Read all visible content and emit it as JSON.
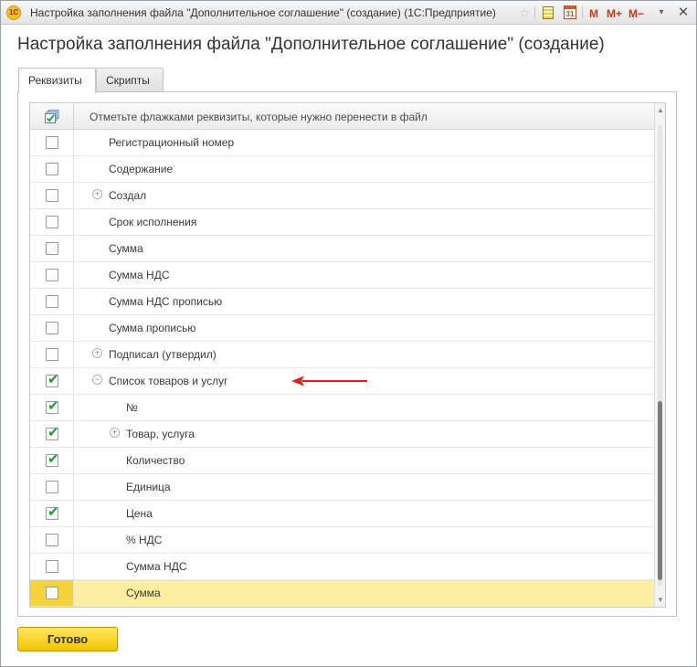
{
  "window": {
    "app_icon_text": "1С",
    "title": "Настройка заполнения файла \"Дополнительное соглашение\" (создание)  (1С:Предприятие)",
    "toolbar": {
      "calendar_day": "31",
      "m_label": "M",
      "m_plus_label": "M+",
      "m_minus_label": "M−",
      "menu_glyph": "▾",
      "close_glyph": "✕"
    }
  },
  "form": {
    "title": "Настройка заполнения файла \"Дополнительное соглашение\" (создание)",
    "tabs": [
      {
        "label": "Реквизиты",
        "active": true
      },
      {
        "label": "Скрипты",
        "active": false
      }
    ],
    "grid": {
      "header_text": "Отметьте флажками реквизиты, которые нужно перенести в файл",
      "rows": [
        {
          "label": "Регистрационный номер",
          "checked": false,
          "level": 1,
          "expander": ""
        },
        {
          "label": "Содержание",
          "checked": false,
          "level": 1,
          "expander": ""
        },
        {
          "label": "Создал",
          "checked": false,
          "level": 1,
          "expander": "+"
        },
        {
          "label": "Срок исполнения",
          "checked": false,
          "level": 1,
          "expander": ""
        },
        {
          "label": "Сумма",
          "checked": false,
          "level": 1,
          "expander": ""
        },
        {
          "label": "Сумма НДС",
          "checked": false,
          "level": 1,
          "expander": ""
        },
        {
          "label": "Сумма НДС прописью",
          "checked": false,
          "level": 1,
          "expander": ""
        },
        {
          "label": "Сумма прописью",
          "checked": false,
          "level": 1,
          "expander": ""
        },
        {
          "label": "Подписал (утвердил)",
          "checked": false,
          "level": 1,
          "expander": "+"
        },
        {
          "label": "Список товаров и услуг",
          "checked": true,
          "level": 1,
          "expander": "−"
        },
        {
          "label": "№",
          "checked": true,
          "level": 2,
          "expander": ""
        },
        {
          "label": "Товар, услуга",
          "checked": true,
          "level": 2,
          "expander": "+"
        },
        {
          "label": "Количество",
          "checked": true,
          "level": 2,
          "expander": ""
        },
        {
          "label": "Единица",
          "checked": false,
          "level": 2,
          "expander": ""
        },
        {
          "label": "Цена",
          "checked": true,
          "level": 2,
          "expander": ""
        },
        {
          "label": "% НДС",
          "checked": false,
          "level": 2,
          "expander": ""
        },
        {
          "label": "Сумма НДС",
          "checked": false,
          "level": 2,
          "expander": ""
        },
        {
          "label": "Сумма",
          "checked": false,
          "level": 2,
          "expander": "",
          "selected": true
        }
      ]
    },
    "ok_button_label": "Готово"
  },
  "colors": {
    "selected_row": "#fbeea1",
    "selected_check_cell": "#f5d33a",
    "checkmark": "#1f9a3a",
    "arrow": "#d9201b",
    "ok_button": "#f5cc10"
  }
}
